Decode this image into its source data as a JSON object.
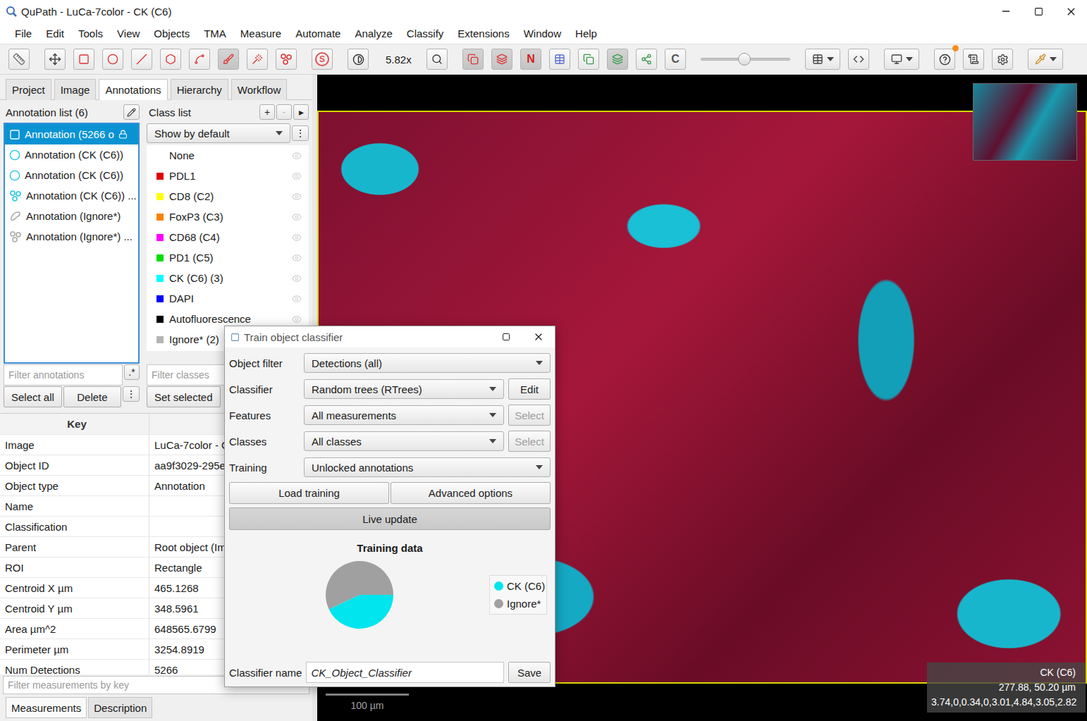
{
  "window": {
    "title": "QuPath - LuCa-7color - CK (C6)"
  },
  "menu": [
    "File",
    "Edit",
    "Tools",
    "View",
    "Objects",
    "TMA",
    "Measure",
    "Automate",
    "Analyze",
    "Classify",
    "Extensions",
    "Window",
    "Help"
  ],
  "toolbar": [
    {
      "kind": "icon",
      "selected": false,
      "badge": false
    },
    {
      "kind": "icon",
      "selected": false,
      "badge": false
    },
    {
      "kind": "icon",
      "selected": false,
      "badge": false
    },
    {
      "kind": "icon",
      "selected": false,
      "badge": false
    },
    {
      "kind": "icon",
      "selected": false,
      "badge": false
    },
    {
      "kind": "icon",
      "selected": false,
      "badge": false
    },
    {
      "kind": "icon",
      "selected": false,
      "badge": false
    },
    {
      "kind": "icon",
      "selected": true,
      "badge": false
    },
    {
      "kind": "icon",
      "selected": false,
      "badge": false
    },
    {
      "kind": "icon",
      "selected": false,
      "badge": false
    },
    {
      "kind": "circle-text",
      "label": "S",
      "selected": false
    },
    {
      "kind": "icon",
      "selected": false,
      "badge": false
    },
    {
      "kind": "zoom",
      "label": "5.82x"
    },
    {
      "kind": "icon",
      "selected": false,
      "badge": false
    },
    {
      "kind": "icon",
      "selected": true,
      "badge": false
    },
    {
      "kind": "icon",
      "selected": true,
      "badge": false
    },
    {
      "kind": "text",
      "label": "N",
      "selected": true
    },
    {
      "kind": "icon",
      "selected": false,
      "badge": false
    },
    {
      "kind": "icon",
      "selected": false,
      "badge": false
    },
    {
      "kind": "icon",
      "selected": true,
      "badge": false
    },
    {
      "kind": "icon",
      "selected": false,
      "badge": false
    },
    {
      "kind": "text",
      "label": "C",
      "selected": false
    },
    {
      "kind": "slider",
      "level": 0.49
    },
    {
      "kind": "dropdown",
      "selected": false,
      "badge": false
    },
    {
      "kind": "icon",
      "selected": false,
      "badge": false
    },
    {
      "kind": "dropdown",
      "selected": false,
      "badge": false
    },
    {
      "kind": "icon",
      "selected": false,
      "badge": true
    },
    {
      "kind": "icon",
      "selected": false,
      "badge": false
    },
    {
      "kind": "icon",
      "selected": false,
      "badge": false
    },
    {
      "kind": "dropdown",
      "selected": false,
      "badge": false
    }
  ],
  "left_tabs": [
    {
      "label": "Project",
      "selected": false
    },
    {
      "label": "Image",
      "selected": false
    },
    {
      "label": "Annotations",
      "selected": true
    },
    {
      "label": "Hierarchy",
      "selected": false
    },
    {
      "label": "Workflow",
      "selected": false
    }
  ],
  "annotation_list": {
    "title": "Annotation list (6)",
    "items": [
      {
        "label": "Annotation (5266 o",
        "roi": "rectangle",
        "color": "#ffffff",
        "locked": true,
        "selected": true
      },
      {
        "label": "Annotation (CK (C6))",
        "roi": "ellipse",
        "color": "#1fc8e0",
        "locked": false,
        "selected": false
      },
      {
        "label": "Annotation (CK (C6))",
        "roi": "ellipse",
        "color": "#1fc8e0",
        "locked": false,
        "selected": false
      },
      {
        "label": "Annotation (CK (C6)) ...",
        "roi": "points",
        "color": "#1fc8e0",
        "locked": false,
        "selected": false
      },
      {
        "label": "Annotation (Ignore*)",
        "roi": "area",
        "color": "#a8a8a8",
        "locked": false,
        "selected": false
      },
      {
        "label": "Annotation (Ignore*) ...",
        "roi": "points",
        "color": "#a8a8a8",
        "locked": false,
        "selected": false
      }
    ],
    "filter_placeholder": "Filter annotations",
    "regex_button": ".*",
    "buttons": [
      "Select all",
      "Delete"
    ],
    "more_button": "⋮"
  },
  "class_list": {
    "title": "Class list",
    "header_buttons": [
      {
        "label": "+",
        "disabled": false
      },
      {
        "label": "-",
        "disabled": true
      },
      {
        "label": "▸",
        "disabled": false
      }
    ],
    "show_mode": "Show by default",
    "more_button": "⋮",
    "items": [
      {
        "label": "None",
        "selected": false
      },
      {
        "label": "PDL1",
        "color": "#e00000",
        "selected": false
      },
      {
        "label": "CD8 (C2)",
        "color": "#ffff00",
        "selected": false
      },
      {
        "label": "FoxP3 (C3)",
        "color": "#ff8000",
        "selected": false
      },
      {
        "label": "CD68 (C4)",
        "color": "#ff00ff",
        "selected": false
      },
      {
        "label": "PD1 (C5)",
        "color": "#00dd00",
        "selected": false
      },
      {
        "label": "CK (C6) (3)",
        "color": "#00ffff",
        "selected": false
      },
      {
        "label": "DAPI",
        "color": "#0000ff",
        "selected": false
      },
      {
        "label": "Autofluorescence",
        "color": "#000000",
        "selected": false
      },
      {
        "label": "Ignore* (2)",
        "color": "#b4b4b4",
        "selected": false
      }
    ],
    "filter_placeholder": "Filter classes",
    "buttons": [
      "Set selected"
    ]
  },
  "properties": {
    "columns": [
      "Key",
      "Va"
    ],
    "rows": [
      [
        "Image",
        "LuCa-7color - C"
      ],
      [
        "Object ID",
        "aa9f3029-295e"
      ],
      [
        "Object type",
        "Annotation"
      ],
      [
        "Name",
        ""
      ],
      [
        "Classification",
        ""
      ],
      [
        "Parent",
        "Root object (Im"
      ],
      [
        "ROI",
        "Rectangle"
      ],
      [
        "Centroid X µm",
        "465.1268"
      ],
      [
        "Centroid Y µm",
        "348.5961"
      ],
      [
        "Area µm^2",
        "648565.6799"
      ],
      [
        "Perimeter µm",
        "3254.8919"
      ],
      [
        "Num Detections",
        "5266"
      ]
    ],
    "filter_placeholder": "Filter measurements by key",
    "tabs": [
      {
        "label": "Measurements",
        "selected": true
      },
      {
        "label": "Description",
        "selected": false
      }
    ]
  },
  "viewer": {
    "overlay": [
      "CK (C6)",
      "277.88, 50.20 µm",
      "3.74,0,0.34,0,3.01,4.84,3.05,2.82"
    ],
    "scale_bar": "100 µm"
  },
  "dialog": {
    "title": "Train object classifier",
    "rows": [
      {
        "label": "Object filter",
        "value": "Detections (all)"
      },
      {
        "label": "Classifier",
        "value": "Random trees (RTrees)",
        "button": {
          "label": "Edit",
          "disabled": false
        }
      },
      {
        "label": "Features",
        "value": "All measurements",
        "button": {
          "label": "Select",
          "disabled": true
        }
      },
      {
        "label": "Classes",
        "value": "All classes",
        "button": {
          "label": "Select",
          "disabled": true
        }
      },
      {
        "label": "Training",
        "value": "Unlocked annotations"
      }
    ],
    "actions": [
      "Load training",
      "Advanced options"
    ],
    "live_update": {
      "label": "Live update",
      "selected": true
    },
    "chart": {
      "title": "Training data",
      "series": [
        {
          "label": "CK (C6)",
          "value": 0.43,
          "color": "#00e5ee"
        },
        {
          "label": "Ignore*",
          "value": 0.57,
          "color": "#a0a0a0"
        }
      ]
    },
    "name_field": {
      "label": "Classifier name",
      "value": "CK_Object_Classifier"
    },
    "save": "Save"
  }
}
